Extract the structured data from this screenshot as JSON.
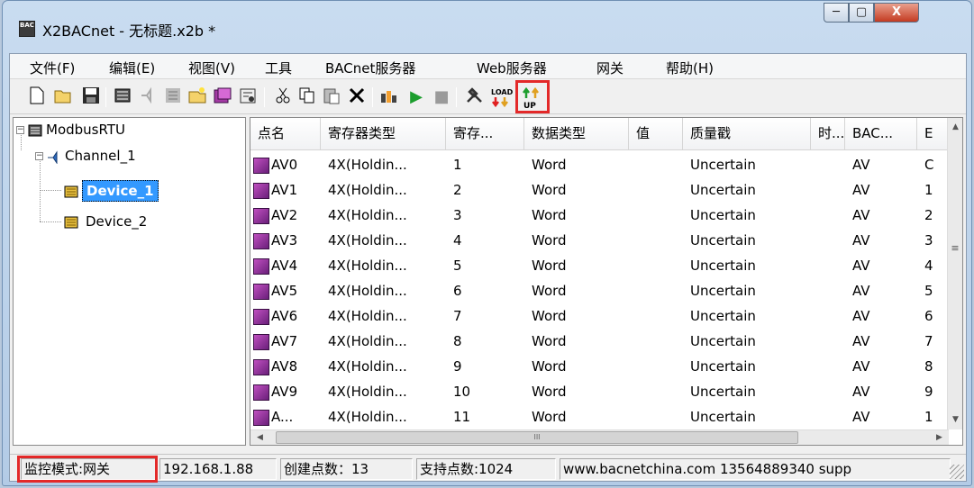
{
  "window": {
    "title": "X2BACnet - 无标题.x2b *",
    "icon_text": "BAC",
    "min": "─",
    "max": "▢",
    "close": "X"
  },
  "menu": [
    "文件(F)",
    "编辑(E)",
    "视图(V)",
    "工具",
    "BACnet服务器",
    "Web服务器",
    "网关",
    "帮助(H)"
  ],
  "toolbar": {
    "load_label": "LOAD",
    "up_label": "UP",
    "play": "▶",
    "stop": "■"
  },
  "tree": {
    "root": "ModbusRTU",
    "channel": "Channel_1",
    "devices": [
      "Device_1",
      "Device_2"
    ],
    "selected": "Device_1"
  },
  "table": {
    "columns": [
      "点名",
      "寄存器类型",
      "寄存...",
      "数据类型",
      "值",
      "质量戳",
      "时...",
      "BAC...",
      "E"
    ],
    "rows": [
      [
        "AV0",
        "4X(Holdin...",
        "1",
        "Word",
        "",
        "Uncertain",
        "",
        "AV",
        "C"
      ],
      [
        "AV1",
        "4X(Holdin...",
        "2",
        "Word",
        "",
        "Uncertain",
        "",
        "AV",
        "1"
      ],
      [
        "AV2",
        "4X(Holdin...",
        "3",
        "Word",
        "",
        "Uncertain",
        "",
        "AV",
        "2"
      ],
      [
        "AV3",
        "4X(Holdin...",
        "4",
        "Word",
        "",
        "Uncertain",
        "",
        "AV",
        "3"
      ],
      [
        "AV4",
        "4X(Holdin...",
        "5",
        "Word",
        "",
        "Uncertain",
        "",
        "AV",
        "4"
      ],
      [
        "AV5",
        "4X(Holdin...",
        "6",
        "Word",
        "",
        "Uncertain",
        "",
        "AV",
        "5"
      ],
      [
        "AV6",
        "4X(Holdin...",
        "7",
        "Word",
        "",
        "Uncertain",
        "",
        "AV",
        "6"
      ],
      [
        "AV7",
        "4X(Holdin...",
        "8",
        "Word",
        "",
        "Uncertain",
        "",
        "AV",
        "7"
      ],
      [
        "AV8",
        "4X(Holdin...",
        "9",
        "Word",
        "",
        "Uncertain",
        "",
        "AV",
        "8"
      ],
      [
        "AV9",
        "4X(Holdin...",
        "10",
        "Word",
        "",
        "Uncertain",
        "",
        "AV",
        "9"
      ],
      [
        "A...",
        "4X(Holdin...",
        "11",
        "Word",
        "",
        "Uncertain",
        "",
        "AV",
        "1"
      ]
    ],
    "hscroll_mid": "III"
  },
  "status": {
    "mode": "监控模式:网关",
    "ip": "192.168.1.88",
    "created": "创建点数：13",
    "supported": "支持点数:1024",
    "site": "www.bacnetchina.com 13564889340 supp"
  }
}
